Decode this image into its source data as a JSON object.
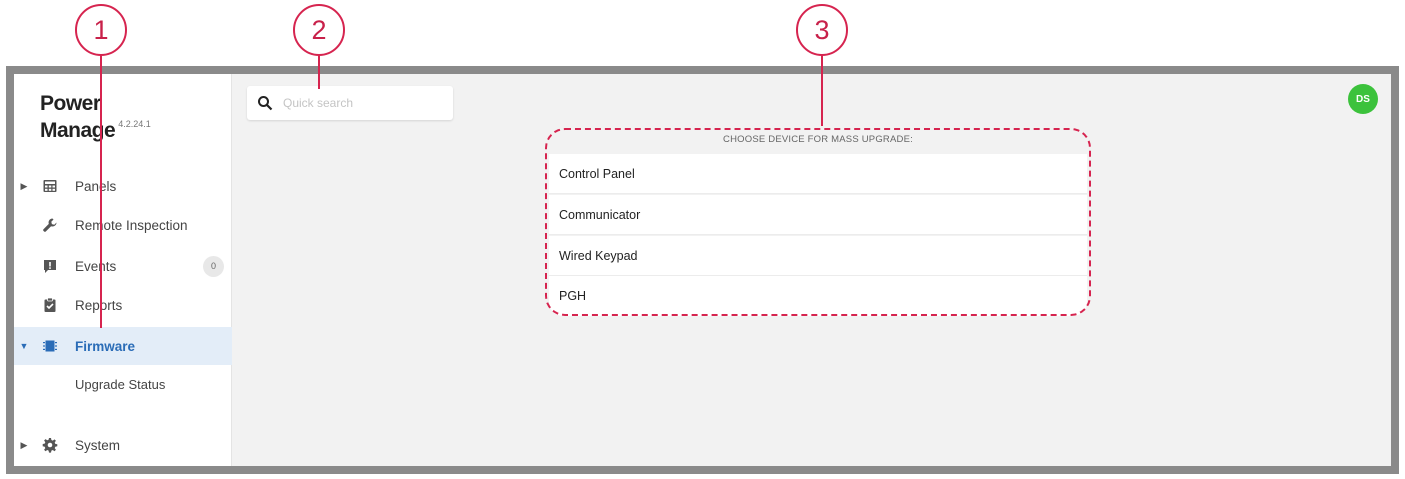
{
  "callouts": [
    "1",
    "2",
    "3"
  ],
  "app": {
    "logo_line1": "Power",
    "logo_line2": "Manage",
    "version": "4.2.24.1"
  },
  "sidebar": {
    "items": [
      {
        "label": "Panels",
        "icon": "panel-icon",
        "expandable": true
      },
      {
        "label": "Remote Inspection",
        "icon": "wrench-icon"
      },
      {
        "label": "Events",
        "icon": "alert-icon",
        "count": "0"
      },
      {
        "label": "Reports",
        "icon": "clipboard-check-icon"
      },
      {
        "label": "Firmware",
        "icon": "chip-icon",
        "expanded": true,
        "active": true
      },
      {
        "label": "Upgrade Status",
        "sub": true
      },
      {
        "label": "System",
        "icon": "gear-icon",
        "expandable": true
      }
    ]
  },
  "search": {
    "placeholder": "Quick search",
    "value": ""
  },
  "user": {
    "initials": "DS",
    "avatar_color": "#3cc23c"
  },
  "mass_upgrade": {
    "title": "CHOOSE DEVICE FOR MASS UPGRADE:",
    "devices": [
      "Control Panel",
      "Communicator",
      "Wired Keypad",
      "PGH"
    ]
  },
  "colors": {
    "accent": "#2a6cb7",
    "callout": "#d6244f",
    "active_bg": "#e3edf8"
  }
}
